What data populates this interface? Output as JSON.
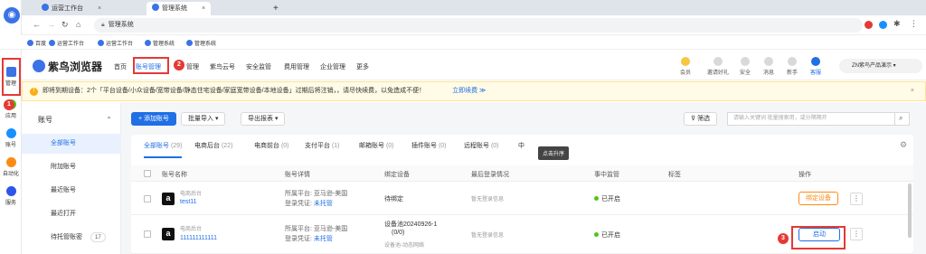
{
  "browser": {
    "tabs": [
      {
        "label": "运营工作台"
      },
      {
        "label": "管理系统"
      }
    ],
    "url": "管理系统",
    "bookmarks": [
      "百度",
      "运营工作台",
      "运营工作台",
      "管理系统",
      "管理系统"
    ]
  },
  "rail": {
    "items": [
      {
        "label": "管理"
      },
      {
        "label": "应用"
      },
      {
        "label": "账号"
      },
      {
        "label": "自动化"
      },
      {
        "label": "服务"
      }
    ]
  },
  "app": {
    "brand": "紫鸟浏览器",
    "nav": [
      {
        "label": "首页"
      },
      {
        "label": "账号管理"
      },
      {
        "label": "管理"
      },
      {
        "label": "紫鸟云号"
      },
      {
        "label": "安全监管"
      },
      {
        "label": "费用管理"
      },
      {
        "label": "企业管理"
      },
      {
        "label": "更多"
      }
    ],
    "tools": [
      {
        "label": "会员"
      },
      {
        "label": "邀请好礼"
      },
      {
        "label": "安全"
      },
      {
        "label": "消息"
      },
      {
        "label": "新手"
      },
      {
        "label": "客服"
      }
    ],
    "user": "ZN紫鸟产品演示"
  },
  "alert": {
    "text": "即将到期设备：2个「平台设备/小众设备/宽带设备/静态住宅设备/家庭宽带设备/本地设备」过期后将注销，，请尽快续费，以免造成不便！",
    "action": "立即续费 ≫"
  },
  "sidebar": {
    "group": "账号",
    "items": [
      {
        "label": "全部账号"
      },
      {
        "label": "附加账号"
      },
      {
        "label": "最近账号"
      },
      {
        "label": "最近打开"
      },
      {
        "label": "待托管账密"
      }
    ],
    "badge": "17"
  },
  "toolbar": {
    "add": "+ 添加账号",
    "import": "批量导入 ▾",
    "export": "导出报表 ▾",
    "filter": "筛选",
    "search_placeholder": "请输入关键词 批量搜索用，或分隔隔开"
  },
  "subtabs": [
    {
      "label": "全部账号",
      "count": "(29)"
    },
    {
      "label": "电商后台",
      "count": "(22)"
    },
    {
      "label": "电商前台",
      "count": "(0)"
    },
    {
      "label": "支付平台",
      "count": "(1)"
    },
    {
      "label": "邮箱账号",
      "count": "(0)"
    },
    {
      "label": "插件账号",
      "count": "(0)"
    },
    {
      "label": "远程账号",
      "count": "(0)"
    },
    {
      "label": "中",
      "count": ""
    }
  ],
  "tooltip": "点击升序",
  "columns": [
    "账号名称",
    "账号详情",
    "绑定设备",
    "最后登录情况",
    "事中监管",
    "标签",
    "操作"
  ],
  "rows": [
    {
      "type": "电商后台",
      "name": "test11",
      "platform": "所属平台: 亚马逊-美国",
      "cred": "登录凭证: ",
      "cred_link": "未托管",
      "device": "待绑定",
      "device2": "",
      "device3": "",
      "last_login": "暂无登录信息",
      "monitor": "已开启",
      "action": "绑定设备"
    },
    {
      "type": "电商后台",
      "name": "111111111111",
      "platform": "所属平台: 亚马逊-美国",
      "cred": "登录凭证: ",
      "cred_link": "未托管",
      "device": "设备池20240926-1",
      "device2": "(0/0)",
      "device3": "设备池-动态网络",
      "last_login": "暂无登录信息",
      "monitor": "已开启",
      "action": "启动"
    }
  ],
  "markers": [
    "1",
    "2",
    "3"
  ],
  "colors": {
    "accent": "#1f6fe5",
    "marker": "#e53935"
  }
}
